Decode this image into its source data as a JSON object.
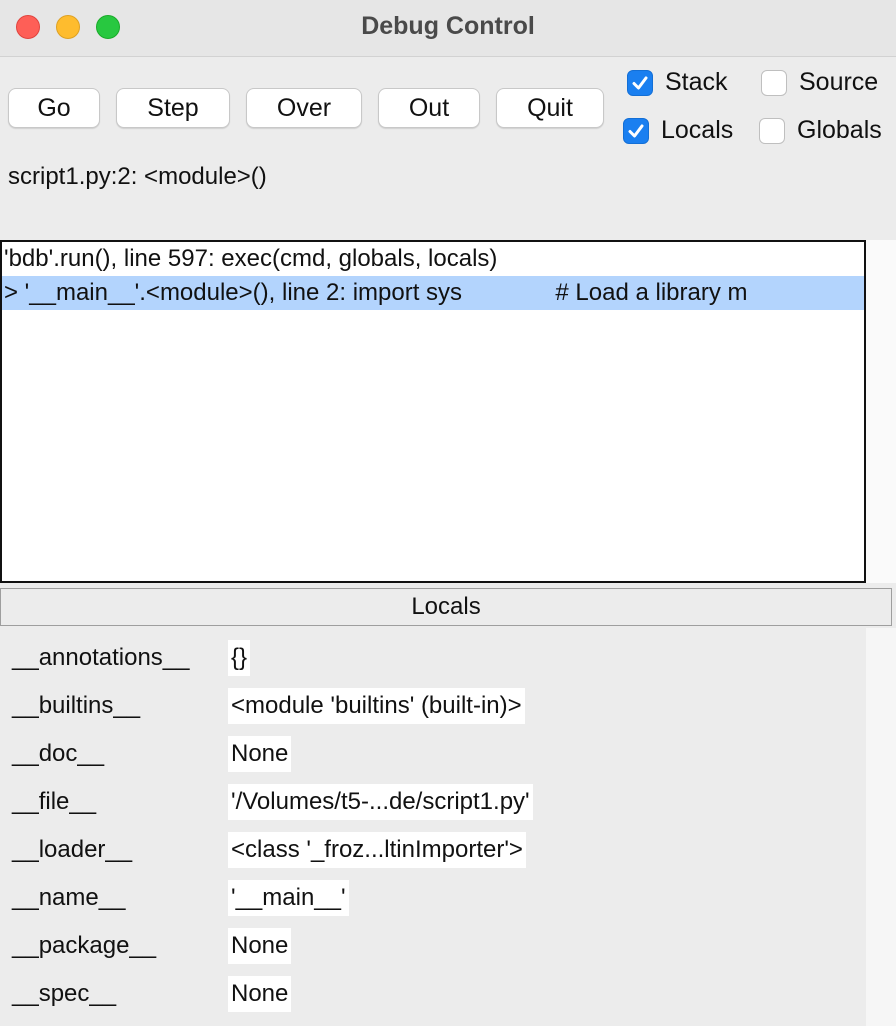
{
  "window": {
    "title": "Debug Control"
  },
  "buttons": {
    "go": "Go",
    "step": "Step",
    "over": "Over",
    "out": "Out",
    "quit": "Quit"
  },
  "checkboxes": {
    "stack": {
      "label": "Stack",
      "checked": true
    },
    "source": {
      "label": "Source",
      "checked": false
    },
    "locals": {
      "label": "Locals",
      "checked": true
    },
    "globals": {
      "label": "Globals",
      "checked": false
    }
  },
  "status": "script1.py:2: <module>()",
  "stack": [
    "'bdb'.run(), line 597: exec(cmd, globals, locals)",
    "> '__main__'.<module>(), line 2: import sys              # Load a library m"
  ],
  "locals": {
    "header": "Locals",
    "rows": [
      {
        "name": "__annotations__",
        "value": "{}"
      },
      {
        "name": "__builtins__",
        "value": "<module 'builtins' (built-in)>"
      },
      {
        "name": "__doc__",
        "value": "None"
      },
      {
        "name": "__file__",
        "value": "'/Volumes/t5-...de/script1.py'"
      },
      {
        "name": "__loader__",
        "value": "<class '_froz...ltinImporter'>"
      },
      {
        "name": "__name__",
        "value": "'__main__'"
      },
      {
        "name": "__package__",
        "value": "None"
      },
      {
        "name": "__spec__",
        "value": "None"
      }
    ]
  }
}
